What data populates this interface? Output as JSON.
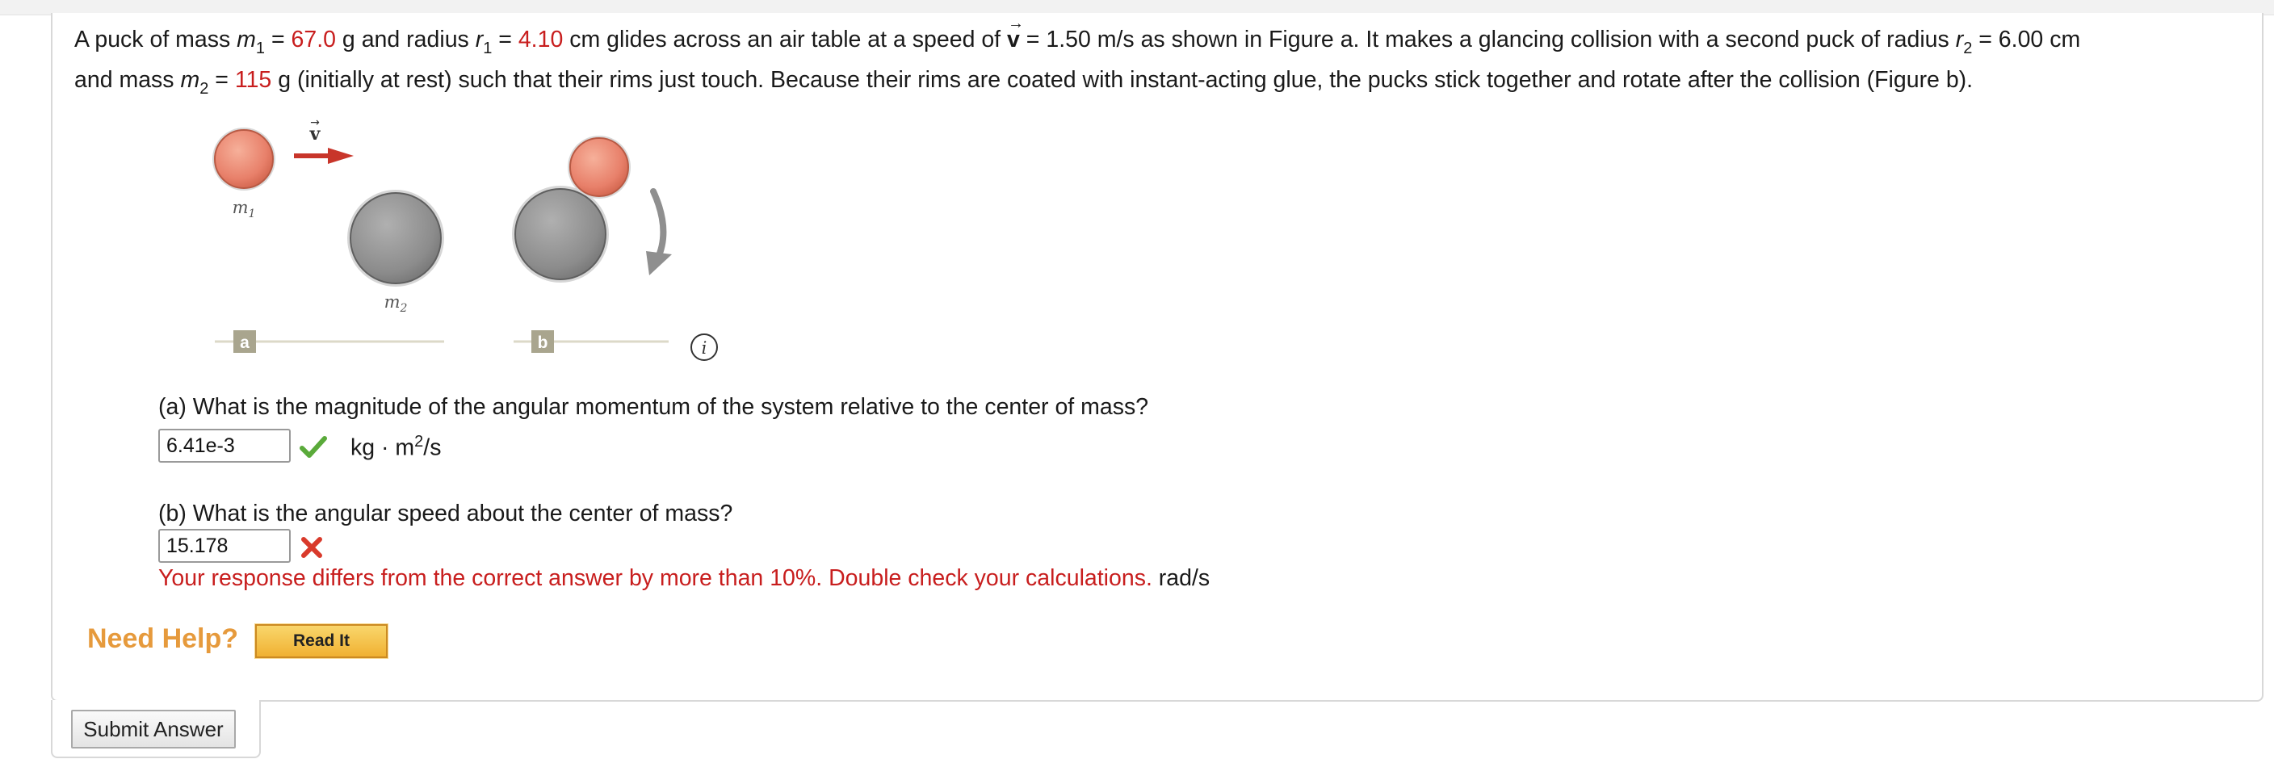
{
  "problem": {
    "t1": "A puck of mass ",
    "m1_sym": "m",
    "m1_sub": "1",
    "t2": " = ",
    "m1_val": "67.0",
    "t3": " g and radius ",
    "r1_sym": "r",
    "r1_sub": "1",
    "t4": " = ",
    "r1_val": "4.10",
    "t5": " cm glides across an air table at a speed of ",
    "v_sym": "v",
    "t6": " = 1.50 m/s as shown in Figure a. It makes a glancing collision with a second puck of radius ",
    "r2_sym": "r",
    "r2_sub": "2",
    "t7": " = 6.00 cm",
    "l2_t1": "and mass ",
    "m2_sym": "m",
    "m2_sub": "2",
    "l2_t2": " = ",
    "m2_val": "115",
    "l2_t3": " g (initially at rest) such that their rims just touch. Because their rims are coated with instant-acting glue, the pucks stick together and rotate after the collision (Figure b)."
  },
  "figure": {
    "label_m1": "m",
    "label_m1_sub": "1",
    "label_m2": "m",
    "label_m2_sub": "2",
    "label_v": "v",
    "tag_a": "a",
    "tag_b": "b",
    "info": "i",
    "colors": {
      "puck_light": "#e8806a",
      "puck_dark": "#888888",
      "arrow": "#c8352a",
      "line": "#dcd9c8",
      "tag": "#a9a58e"
    }
  },
  "part_a": {
    "question": "(a) What is the magnitude of the angular momentum of the system relative to the center of mass?",
    "answer": "6.41e-3",
    "unit_main": "kg · m",
    "unit_sup": "2",
    "unit_end": "/s",
    "status_icon": "checkmark-icon"
  },
  "part_b": {
    "question": "(b) What is the angular speed about the center of mass?",
    "answer": "15.178",
    "status_icon": "cross-icon",
    "feedback": "Your response differs from the correct answer by more than 10%. Double check your calculations.",
    "unit": "rad/s"
  },
  "help": {
    "label": "Need Help?",
    "read_it": "Read It"
  },
  "submit_label": "Submit Answer"
}
